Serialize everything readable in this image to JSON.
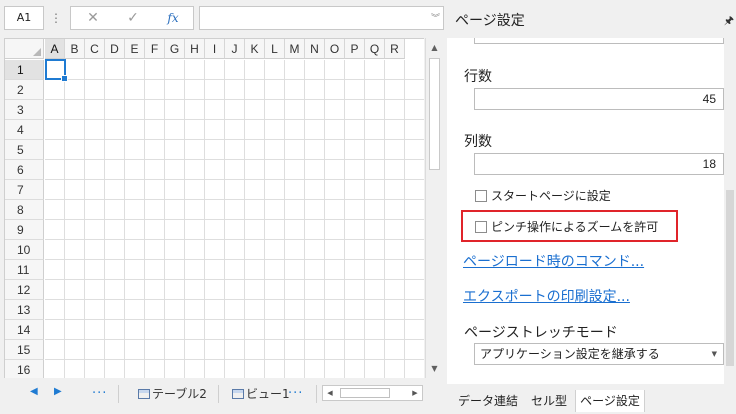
{
  "formula_bar": {
    "name_box": "A1",
    "menu_glyph": "⋮",
    "cancel_glyph": "✕",
    "confirm_glyph": "✓",
    "fx_glyph": "fx",
    "formula_value": "",
    "expand_glyph": "︾"
  },
  "grid": {
    "columns": [
      "A",
      "B",
      "C",
      "D",
      "E",
      "F",
      "G",
      "H",
      "I",
      "J",
      "K",
      "L",
      "M",
      "N",
      "O",
      "P",
      "Q",
      "R"
    ],
    "rows": [
      "1",
      "2",
      "3",
      "4",
      "5",
      "6",
      "7",
      "8",
      "9",
      "10",
      "11",
      "12",
      "13",
      "14",
      "15",
      "16"
    ],
    "active_cell": "A1"
  },
  "sheet_tabs": {
    "prev_glyph": "◀",
    "next_glyph": "▶",
    "more_glyph": "···",
    "tabs": [
      "テーブル2",
      "ビュー1"
    ]
  },
  "panel": {
    "title": "ページ設定",
    "rows_label": "行数",
    "rows_value": "45",
    "cols_label": "列数",
    "cols_value": "18",
    "start_page_label": "スタートページに設定",
    "pinch_zoom_label": "ピンチ操作によるズームを許可",
    "page_load_commands_link": "ページロード時のコマンド...",
    "export_print_settings_link": "エクスポートの印刷設定...",
    "stretch_mode_label": "ページストレッチモード",
    "stretch_mode_value": "アプリケーション設定を継承する",
    "tabs": [
      "データ連結",
      "セル型",
      "ページ設定"
    ],
    "active_tab": "ページ設定"
  },
  "colors": {
    "accent": "#1f7bd2",
    "link": "#1a6fd0",
    "highlight": "#e0242a"
  }
}
